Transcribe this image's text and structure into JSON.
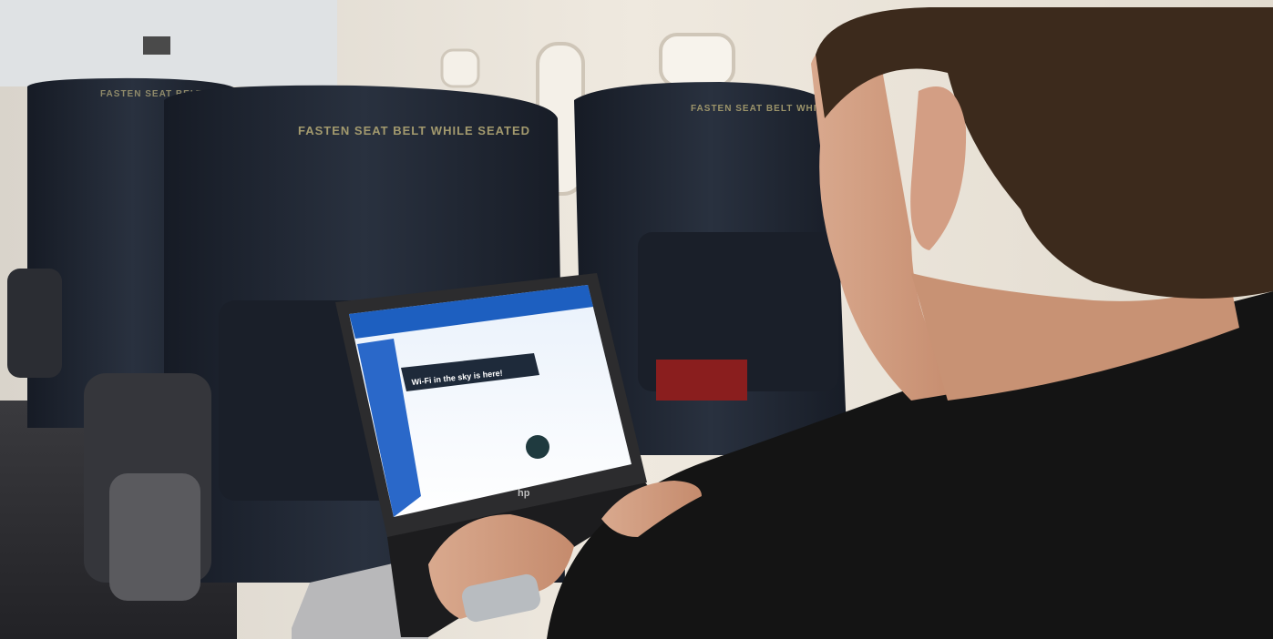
{
  "photo": {
    "seatback_text_left": "FASTEN SEAT BELT WHILE SEATED",
    "seatback_text_right": "FASTEN SEAT BELT WHILE SEATED",
    "laptop_brand": "hp",
    "browser_banner_text": "Wi-Fi in the sky is here!"
  },
  "colors": {
    "cabin_wall": "#e9e4dc",
    "seat_navy": "#1f2633",
    "jacket_black": "#141414",
    "hair_brown": "#3c2a1c",
    "screen_blue": "#1d5fc0"
  }
}
